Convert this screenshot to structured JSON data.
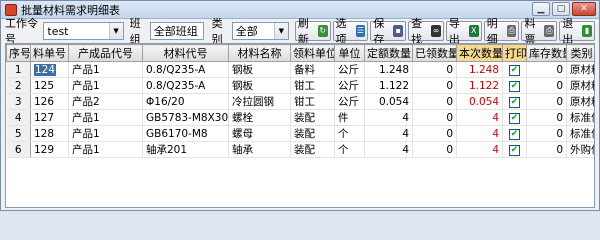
{
  "window": {
    "title": "批量材料需求明细表"
  },
  "toolbar": {
    "work_order_label": "工作令号",
    "work_order_value": "test",
    "team_label": "班组",
    "team_value": "全部班组",
    "category_label": "类别",
    "category_value": "全部",
    "buttons": {
      "refresh": "刷新",
      "options": "选项",
      "save": "保存",
      "find": "查找",
      "export": "导出",
      "detail": "明细",
      "ticket": "料票",
      "exit": "退出"
    }
  },
  "table": {
    "columns": [
      "序号",
      "料单号",
      "产成品代号",
      "材料代号",
      "材料名称",
      "领料单位",
      "单位",
      "定额数量",
      "已领数量",
      "本次数量",
      "打印",
      "库存数量",
      "类别"
    ],
    "rows": [
      {
        "seq": "1",
        "order": "124",
        "product": "产品1",
        "code": "0.8/Q235-A",
        "name": "钢板",
        "dept": "备料",
        "unit": "公斤",
        "quota": "1.248",
        "received": "0",
        "current": "1.248",
        "print": true,
        "stock": "0",
        "category": "原材料"
      },
      {
        "seq": "2",
        "order": "125",
        "product": "产品1",
        "code": "0.8/Q235-A",
        "name": "钢板",
        "dept": "钳工",
        "unit": "公斤",
        "quota": "1.122",
        "received": "0",
        "current": "1.122",
        "print": true,
        "stock": "0",
        "category": "原材料"
      },
      {
        "seq": "3",
        "order": "126",
        "product": "产品2",
        "code": "Φ16/20",
        "name": "冷拉圆钢",
        "dept": "钳工",
        "unit": "公斤",
        "quota": "0.054",
        "received": "0",
        "current": "0.054",
        "print": true,
        "stock": "0",
        "category": "原材料"
      },
      {
        "seq": "4",
        "order": "127",
        "product": "产品1",
        "code": "GB5783-M8X30",
        "name": "螺栓",
        "dept": "装配",
        "unit": "件",
        "quota": "4",
        "received": "0",
        "current": "4",
        "print": true,
        "stock": "0",
        "category": "标准件"
      },
      {
        "seq": "5",
        "order": "128",
        "product": "产品1",
        "code": "GB6170-M8",
        "name": "螺母",
        "dept": "装配",
        "unit": "个",
        "quota": "4",
        "received": "0",
        "current": "4",
        "print": true,
        "stock": "0",
        "category": "标准件"
      },
      {
        "seq": "6",
        "order": "129",
        "product": "产品1",
        "code": "轴承201",
        "name": "轴承",
        "dept": "装配",
        "unit": "个",
        "quota": "4",
        "received": "0",
        "current": "4",
        "print": true,
        "stock": "0",
        "category": "外购件"
      }
    ]
  },
  "colors": {
    "accent": "#3a6ea5",
    "current_qty": "#d00000",
    "header_highlight": "#f6d98f"
  }
}
